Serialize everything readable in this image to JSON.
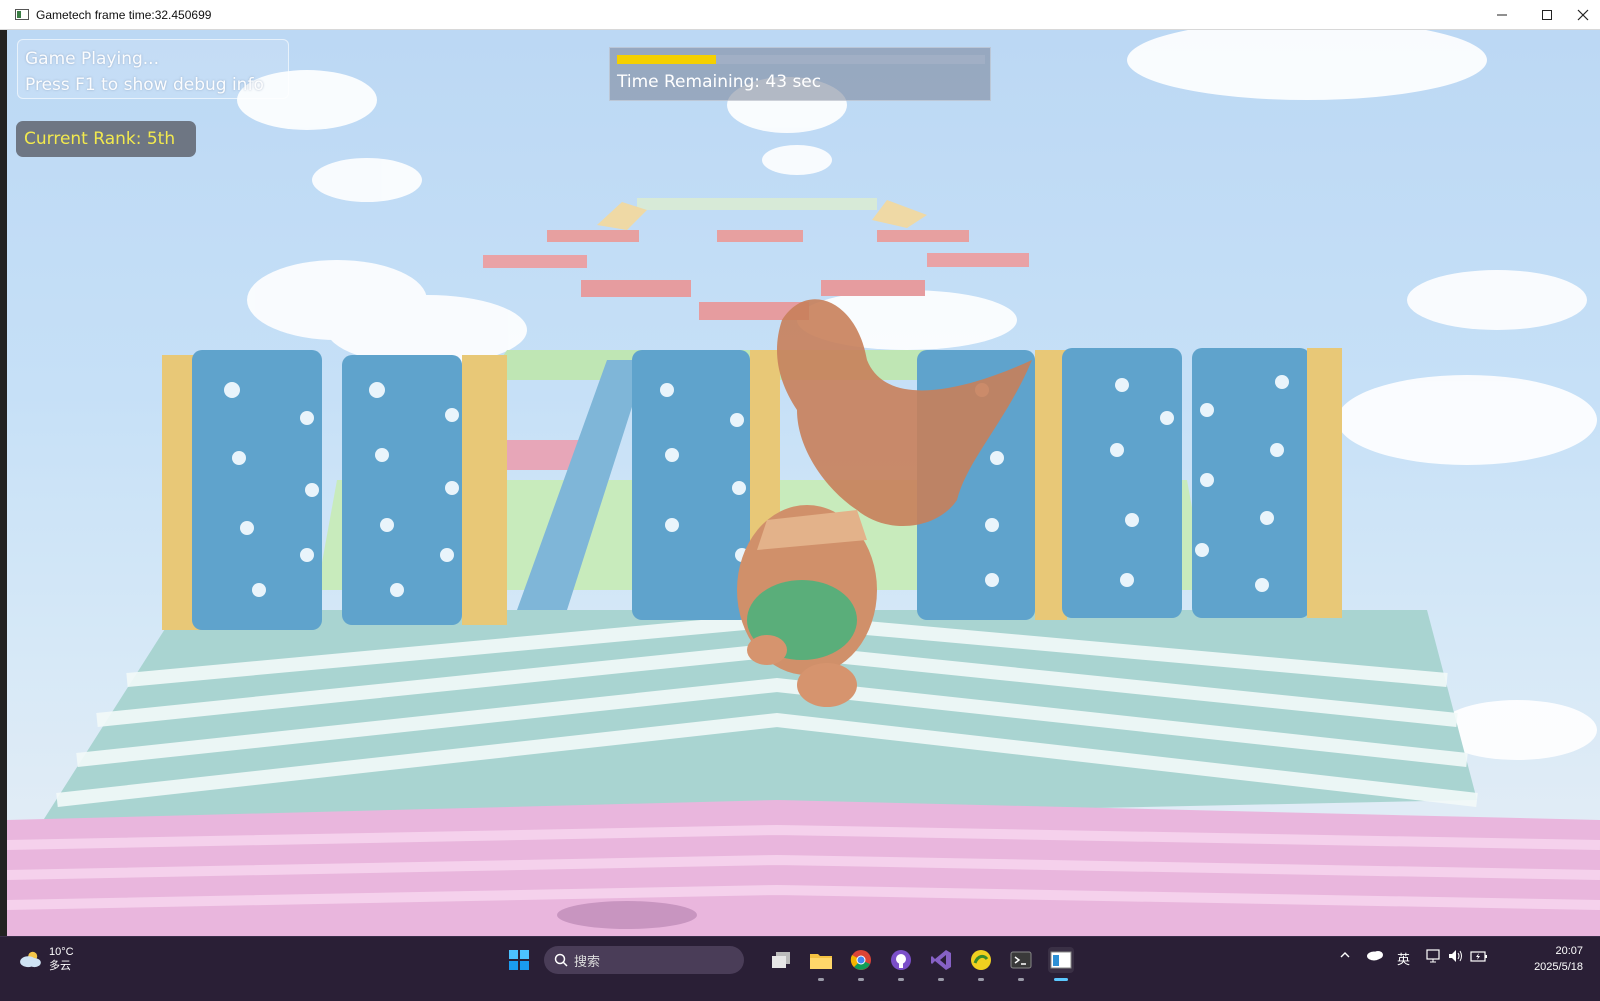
{
  "window": {
    "title": "Gametech frame time:32.450699",
    "controls": [
      "minimize-icon",
      "maximize-icon",
      "close-icon"
    ]
  },
  "hud": {
    "status_line1": "Game Playing...",
    "status_line2": "Press F1 to show debug info",
    "rank_label": "Current Rank: 5th",
    "timer_label": "Time Remaining: 43 sec",
    "timer_progress": 0.27,
    "colors": {
      "rank_text": "#f2e94e",
      "timer_fill": "#f5d000"
    }
  },
  "taskbar": {
    "weather_temp": "10°C",
    "weather_desc": "多云",
    "search_placeholder": "搜索",
    "apps": [
      "windows-start-icon",
      "task-view-icon",
      "file-explorer-icon",
      "chrome-icon",
      "github-desktop-icon",
      "visual-studio-icon",
      "app-yellow-icon",
      "terminal-icon",
      "game-window-icon"
    ],
    "tray_ime": "英",
    "time": "20:07",
    "date": "2025/5/18"
  }
}
